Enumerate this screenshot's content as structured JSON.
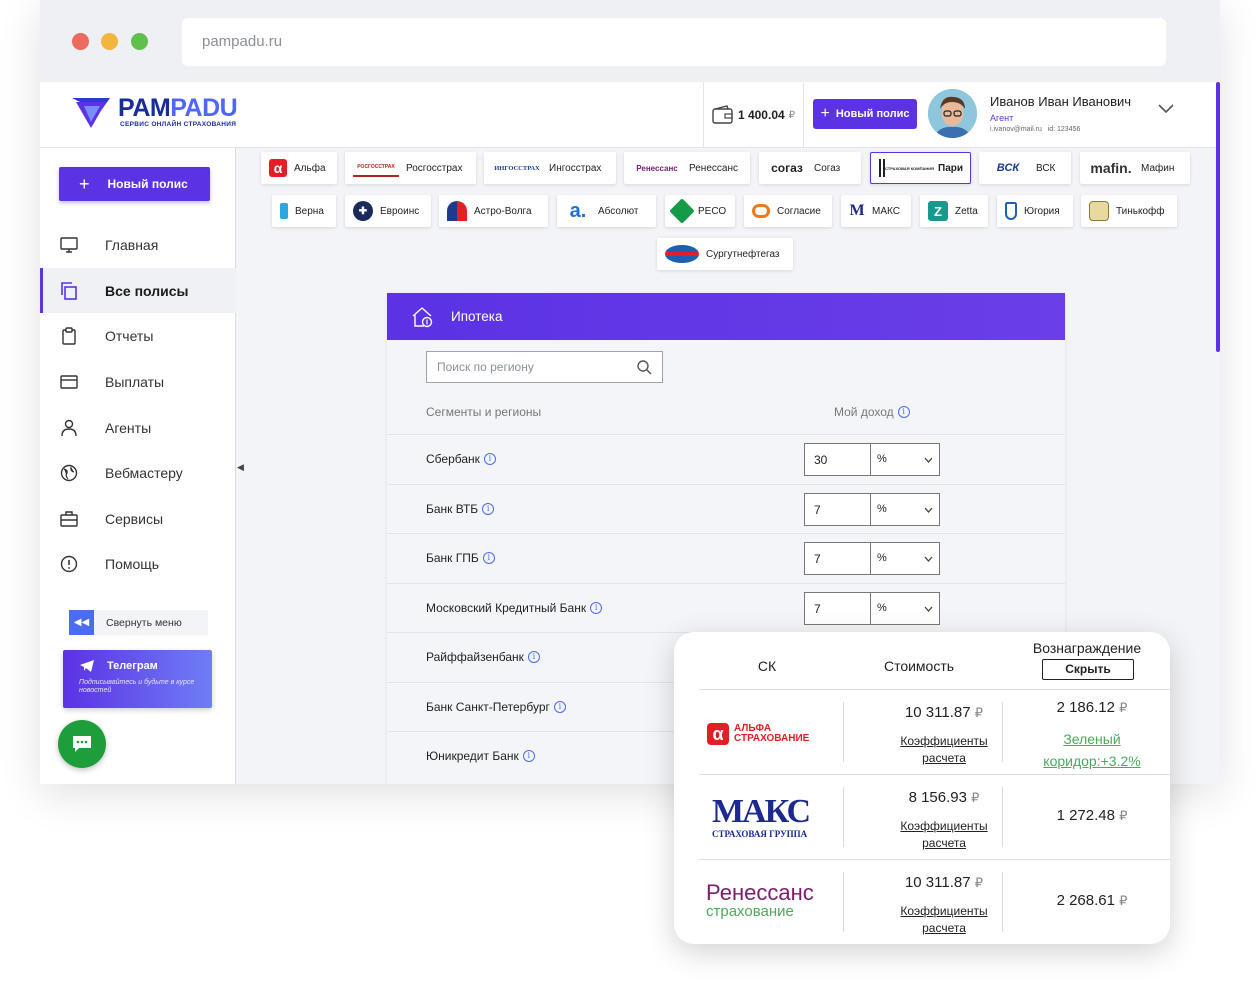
{
  "browser": {
    "url": "pampadu.ru"
  },
  "logo": {
    "name_a": "PAM",
    "name_b": "PADU",
    "tagline": "СЕРВИС ОНЛАЙН СТРАХОВАНИЯ"
  },
  "topbar": {
    "balance": "1 400.04",
    "currency": "₽",
    "new_policy": "Новый полис",
    "user_name": "Иванов Иван Иванович",
    "user_role": "Агент",
    "user_email": "i.ivanov@mail.ru",
    "user_id": "id: 123456"
  },
  "sidebar": {
    "new_policy": "Новый полис",
    "items": [
      {
        "label": "Главная",
        "icon": "monitor-icon"
      },
      {
        "label": "Все полисы",
        "icon": "copy-icon"
      },
      {
        "label": "Отчеты",
        "icon": "clipboard-icon"
      },
      {
        "label": "Выплаты",
        "icon": "card-icon"
      },
      {
        "label": "Агенты",
        "icon": "user-icon"
      },
      {
        "label": "Вебмастеру",
        "icon": "globe-icon"
      },
      {
        "label": "Сервисы",
        "icon": "briefcase-icon"
      },
      {
        "label": "Помощь",
        "icon": "alert-circle-icon"
      }
    ],
    "collapse": "Свернуть меню",
    "telegram_title": "Телеграм",
    "telegram_text": "Подписывайтесь и будьте в курсе новостей"
  },
  "insurers": [
    {
      "label": "Альфа",
      "logo": "α"
    },
    {
      "label": "Росгосстрах",
      "logo": "РОСГОССТРАХ"
    },
    {
      "label": "Ингосстрах",
      "logo": "ИНГОССТРАХ"
    },
    {
      "label": "Ренессанс",
      "logo": "Ренессанс"
    },
    {
      "label": "Согаз",
      "logo": "согаз"
    },
    {
      "label": "Пари",
      "logo": "СТРАХОВАЯ КОМПАНИЯ"
    },
    {
      "label": "ВСК",
      "logo": "ВСК"
    },
    {
      "label": "Мафин",
      "logo": "mafin."
    },
    {
      "label": "Верна",
      "logo": ""
    },
    {
      "label": "Евроинс",
      "logo": ""
    },
    {
      "label": "Астро-Волга",
      "logo": ""
    },
    {
      "label": "Абсолют",
      "logo": "a."
    },
    {
      "label": "РЕСО",
      "logo": ""
    },
    {
      "label": "Согласие",
      "logo": ""
    },
    {
      "label": "МАКС",
      "logo": "M"
    },
    {
      "label": "Zetta",
      "logo": "Z"
    },
    {
      "label": "Югория",
      "logo": ""
    },
    {
      "label": "Тинькофф",
      "logo": ""
    },
    {
      "label": "Сургутнефтегаз",
      "logo": ""
    }
  ],
  "panel": {
    "title": "Ипотека",
    "search_placeholder": "Поиск по региону",
    "col_segments": "Сегменты и регионы",
    "col_income": "Мой доход",
    "rows": [
      {
        "name": "Сбербанк",
        "value": "30",
        "unit": "%"
      },
      {
        "name": "Банк ВТБ",
        "value": "7",
        "unit": "%"
      },
      {
        "name": "Банк ГПБ",
        "value": "7",
        "unit": "%"
      },
      {
        "name": "Московский Кредитный Банк",
        "value": "7",
        "unit": "%"
      },
      {
        "name": "Райффайзенбанк",
        "value": "",
        "unit": ""
      },
      {
        "name": "Банк Санкт-Петербург",
        "value": "",
        "unit": ""
      },
      {
        "name": "Юникредит Банк",
        "value": "",
        "unit": ""
      }
    ]
  },
  "comparison": {
    "col_company": "СК",
    "col_price": "Стоимость",
    "col_reward": "Вознаграждение",
    "hide_label": "Скрыть",
    "coef_label": "Коэффициенты расчета",
    "currency": "₽",
    "rows": [
      {
        "company": "АЛЬФА СТРАХОВАНИЕ",
        "logo_mark": "α",
        "price": "10 311.87",
        "reward": "2 186.12",
        "note": "Зеленый коридор:+3.2%"
      },
      {
        "company": "МАКС",
        "logo_mark": "СТРАХОВАЯ ГРУППА",
        "price": "8 156.93",
        "reward": "1 272.48",
        "note": ""
      },
      {
        "company": "Ренессанс",
        "logo_mark": "страхование",
        "price": "10 311.87",
        "reward": "2 268.61",
        "note": ""
      }
    ]
  }
}
